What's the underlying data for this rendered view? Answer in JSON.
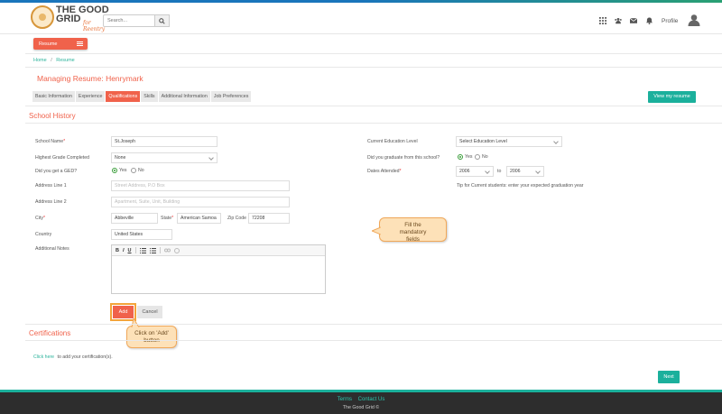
{
  "header": {
    "logo_line1": "THE GOOD",
    "logo_line2": "GRID",
    "logo_sub": "for Reentry",
    "search_placeholder": "Search...",
    "icons": [
      "apps-grid-icon",
      "users-icon",
      "mail-icon",
      "bell-icon"
    ],
    "profile_label": "Profile"
  },
  "resume_bar": {
    "label": "Resume"
  },
  "breadcrumb": {
    "home": "Home",
    "sep": "/",
    "current": "Resume"
  },
  "page_title": "Managing Resume: Henrymark",
  "tabs": [
    {
      "label": "Basic Information",
      "active": false
    },
    {
      "label": "Experience",
      "active": false
    },
    {
      "label": "Qualifications",
      "active": true
    },
    {
      "label": "Skills",
      "active": false
    },
    {
      "label": "Additional Information",
      "active": false
    },
    {
      "label": "Job Preferences",
      "active": false
    }
  ],
  "view_resume_label": "View my resume",
  "school_history": {
    "title": "School History",
    "school_name": {
      "label": "School Name",
      "value": "St.Joseph"
    },
    "highest_grade": {
      "label": "Highest Grade Completed",
      "value": "None"
    },
    "ged": {
      "label": "Did you get a GED?",
      "yes": "Yes",
      "no": "No",
      "selected": "Yes"
    },
    "address1": {
      "label": "Address Line 1",
      "placeholder": "Street Address, P.O Box"
    },
    "address2": {
      "label": "Address Line 2",
      "placeholder": "Apartment, Suite, Unit, Building"
    },
    "city": {
      "label": "City",
      "value": "Abbeville"
    },
    "state": {
      "label": "State",
      "value": "American Samoa"
    },
    "zip": {
      "label": "Zip Code",
      "value": "72208"
    },
    "country": {
      "label": "Country",
      "value": "United States"
    },
    "notes": {
      "label": "Additional Notes"
    },
    "editor_tools": [
      "B",
      "I",
      "U"
    ],
    "education_level": {
      "label": "Current Education Level",
      "value": "Select Education Level"
    },
    "graduate": {
      "label": "Did you graduate from this school?",
      "yes": "Yes",
      "no": "No",
      "selected": "Yes"
    },
    "dates": {
      "label": "Dates Attended",
      "from": "2006",
      "to_label": "to",
      "to": "2006"
    },
    "tip": "Tip for Current students: enter your expected graduation year",
    "add_label": "Add",
    "cancel_label": "Cancel"
  },
  "callouts": {
    "fill": "Fill the mandatory fields",
    "add": "Click on 'Add' button"
  },
  "certifications": {
    "title": "Certifications",
    "link": "Click here",
    "text": "to add your certification(s)."
  },
  "next_label": "Next",
  "footer": {
    "terms": "Terms",
    "contact": "Contact Us",
    "copyright": "The Good Grid ©"
  },
  "colors": {
    "accent": "#f0624b",
    "teal": "#1bb09c",
    "callout": "#fde1b8"
  }
}
